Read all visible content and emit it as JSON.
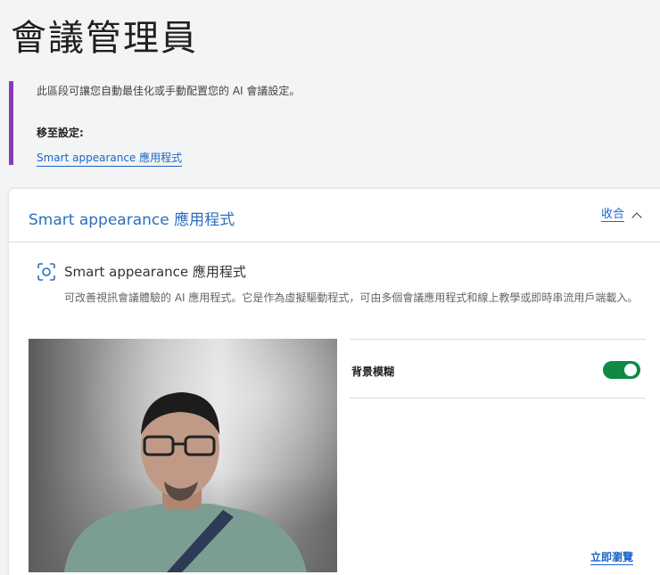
{
  "page": {
    "title": "會議管理員"
  },
  "info": {
    "description": "此區段可讓您自動最佳化或手動配置您的 AI 會議設定。",
    "goto_label": "移至設定:",
    "goto_link": "Smart appearance 應用程式"
  },
  "card": {
    "title": "Smart appearance 應用程式",
    "collapse_label": "收合",
    "app_name": "Smart appearance 應用程式",
    "app_description": "可改善視訊會議體驗的 AI 應用程式。它是作為虛擬驅動程式，可由多個會議應用程式和線上教學或即時串流用戶端載入。",
    "settings": {
      "background_blur_label": "背景模糊",
      "background_blur_enabled": true
    },
    "preview_link": "立即瀏覽"
  },
  "colors": {
    "accent_bar": "#8a3ab9",
    "link": "#1a66c7",
    "toggle_on": "#0e8a45"
  },
  "icons": {
    "app": "face-focus-icon",
    "collapse": "chevron-up-icon"
  }
}
